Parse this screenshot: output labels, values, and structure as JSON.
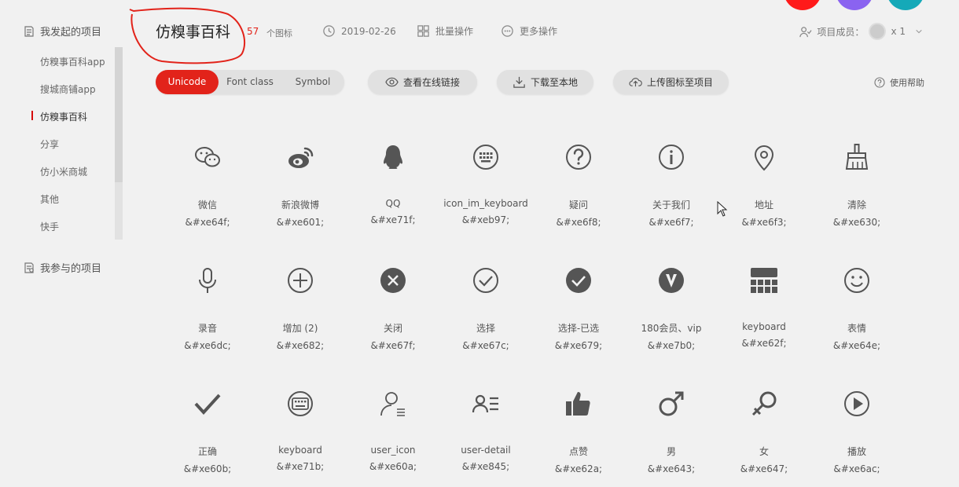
{
  "sidebar": {
    "my_projects_label": "我发起的项目",
    "projects": [
      {
        "label": "仿糗事百科app",
        "active": false
      },
      {
        "label": "搜城商铺app",
        "active": false
      },
      {
        "label": "仿糗事百科",
        "active": true
      },
      {
        "label": "分享",
        "active": false
      },
      {
        "label": "仿小米商城",
        "active": false
      },
      {
        "label": "其他",
        "active": false
      },
      {
        "label": "快手",
        "active": false
      }
    ],
    "joined_projects_label": "我参与的项目"
  },
  "header": {
    "title": "仿糗事百科",
    "icon_count": "57",
    "icon_count_unit": "个图标",
    "date": "2019-02-26",
    "batch_label": "批量操作",
    "more_label": "更多操作",
    "members_label": "项目成员：",
    "members_count": "x 1"
  },
  "toolbar": {
    "tabs": [
      "Unicode",
      "Font class",
      "Symbol"
    ],
    "active_tab": "Unicode",
    "view_link_label": "查看在线链接",
    "download_label": "下载至本地",
    "upload_label": "上传图标至项目",
    "help_label": "使用帮助"
  },
  "icons": [
    {
      "name": "微信",
      "code": "&#xe64f;",
      "icon": "wechat-icon"
    },
    {
      "name": "新浪微博",
      "code": "&#xe601;",
      "icon": "weibo-icon"
    },
    {
      "name": "QQ",
      "code": "&#xe71f;",
      "icon": "qq-icon"
    },
    {
      "name": "icon_im_keyboard",
      "code": "&#xeb97;",
      "icon": "keyboard-round-icon"
    },
    {
      "name": "疑问",
      "code": "&#xe6f8;",
      "icon": "question-icon"
    },
    {
      "name": "关于我们",
      "code": "&#xe6f7;",
      "icon": "info-icon"
    },
    {
      "name": "地址",
      "code": "&#xe6f3;",
      "icon": "location-icon"
    },
    {
      "name": "清除",
      "code": "&#xe630;",
      "icon": "broom-icon"
    },
    {
      "name": "录音",
      "code": "&#xe6dc;",
      "icon": "microphone-icon"
    },
    {
      "name": "增加 (2)",
      "code": "&#xe682;",
      "icon": "plus-circle-icon"
    },
    {
      "name": "关闭",
      "code": "&#xe67f;",
      "icon": "close-circle-icon"
    },
    {
      "name": "选择",
      "code": "&#xe67c;",
      "icon": "check-circle-icon"
    },
    {
      "name": "选择-已选",
      "code": "&#xe679;",
      "icon": "check-circle-filled-icon"
    },
    {
      "name": "180会员、vip",
      "code": "&#xe7b0;",
      "icon": "vip-icon"
    },
    {
      "name": "keyboard",
      "code": "&#xe62f;",
      "icon": "keyboard-grid-icon"
    },
    {
      "name": "表情",
      "code": "&#xe64e;",
      "icon": "smile-icon"
    },
    {
      "name": "正确",
      "code": "&#xe60b;",
      "icon": "checkmark-icon"
    },
    {
      "name": "keyboard",
      "code": "&#xe71b;",
      "icon": "keyboard-circle-icon"
    },
    {
      "name": "user_icon",
      "code": "&#xe60a;",
      "icon": "user-icon"
    },
    {
      "name": "user-detail",
      "code": "&#xe845;",
      "icon": "user-detail-icon"
    },
    {
      "name": "点赞",
      "code": "&#xe62a;",
      "icon": "thumbs-up-icon"
    },
    {
      "name": "男",
      "code": "&#xe643;",
      "icon": "male-icon"
    },
    {
      "name": "女",
      "code": "&#xe647;",
      "icon": "female-icon"
    },
    {
      "name": "播放",
      "code": "&#xe6ac;",
      "icon": "play-icon"
    }
  ],
  "colors": {
    "accent": "#e2231a",
    "background": "#f1f1f1",
    "icon": "#555555"
  }
}
